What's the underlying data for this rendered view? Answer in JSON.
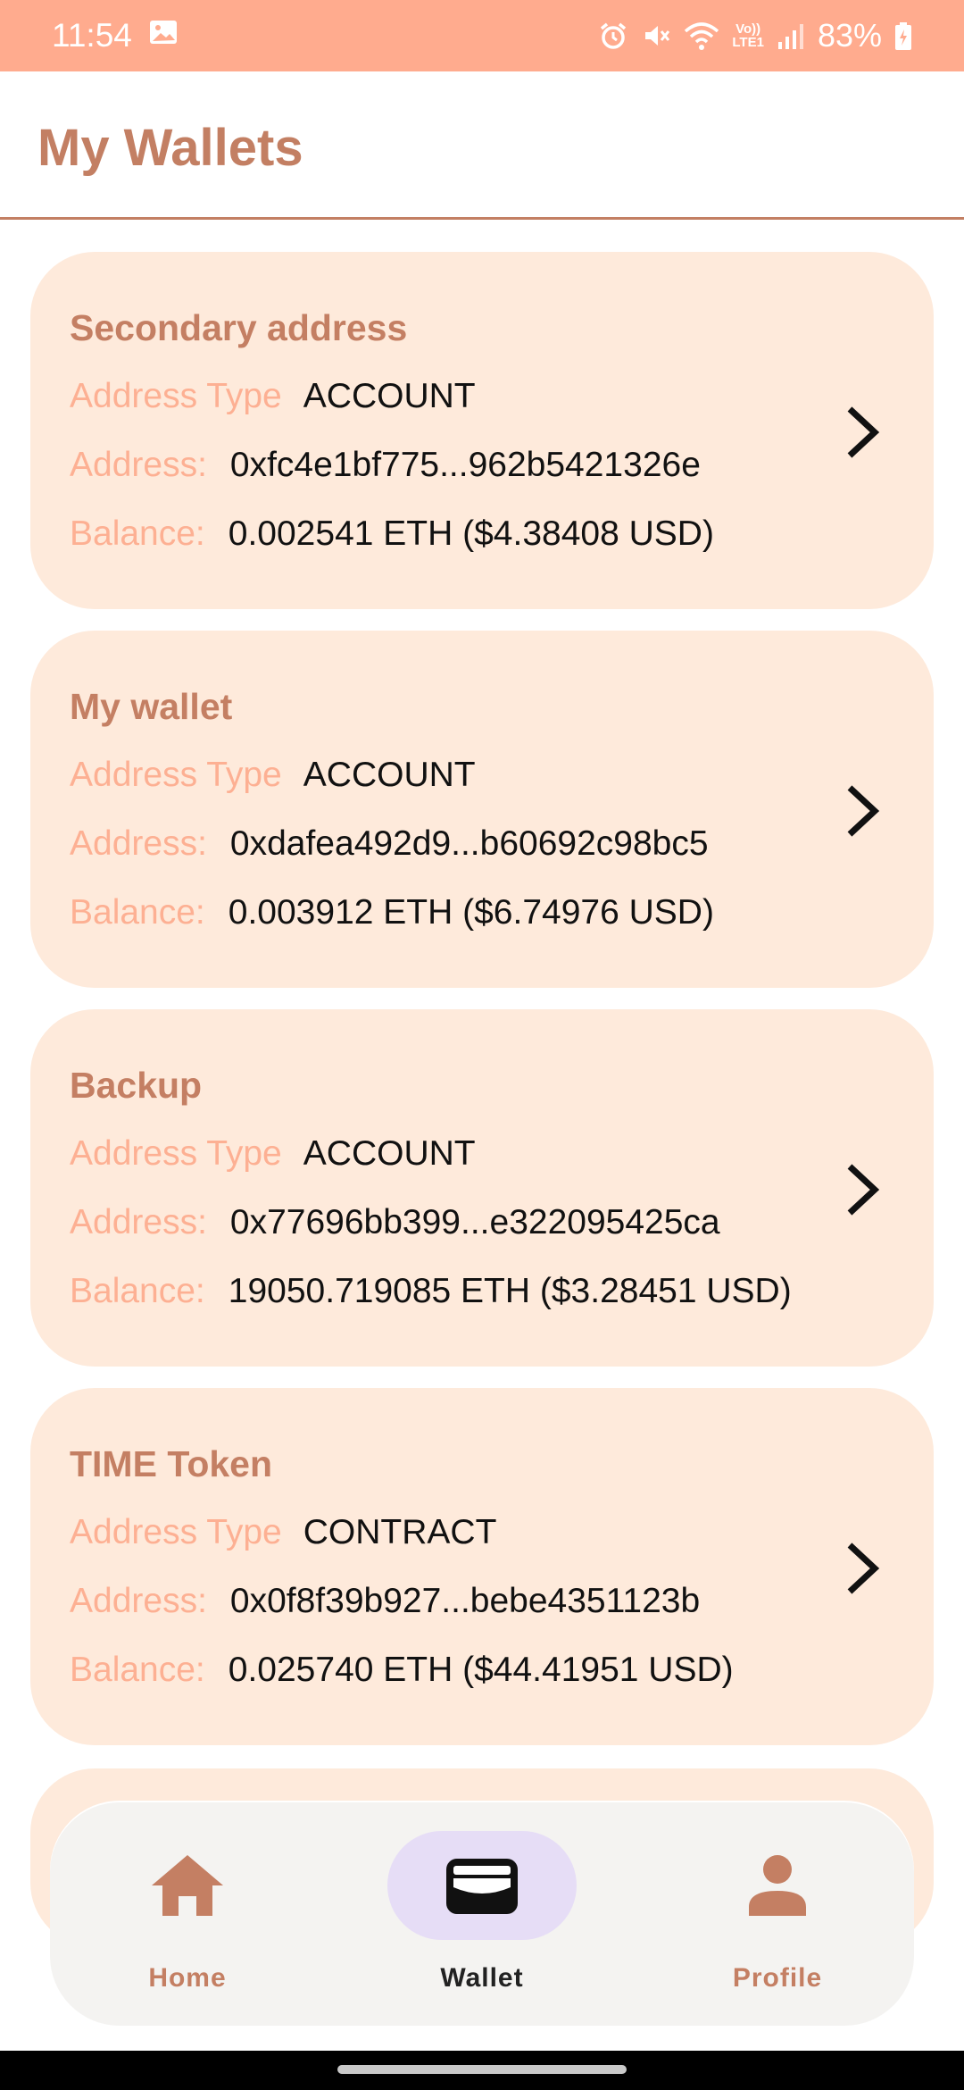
{
  "status_bar": {
    "time": "11:54",
    "battery": "83%",
    "network_label_top": "Vo))",
    "network_label_bottom": "LTE1",
    "icons": [
      "image-icon",
      "alarm-icon",
      "mute-icon",
      "wifi-icon",
      "signal-icon",
      "battery-charging-icon"
    ]
  },
  "header": {
    "title": "My Wallets"
  },
  "labels": {
    "address_type": "Address Type",
    "address": "Address:",
    "balance": "Balance:"
  },
  "wallets": [
    {
      "name": "Secondary address",
      "type": "ACCOUNT",
      "address": "0xfc4e1bf775...962b5421326e",
      "balance": "0.002541 ETH ($4.38408 USD)"
    },
    {
      "name": "My wallet",
      "type": "ACCOUNT",
      "address": "0xdafea492d9...b60692c98bc5",
      "balance": "0.003912 ETH ($6.74976 USD)"
    },
    {
      "name": "Backup",
      "type": "ACCOUNT",
      "address": "0x77696bb399...e322095425ca",
      "balance": "19050.719085 ETH ($3.28451 USD)"
    },
    {
      "name": "TIME Token",
      "type": "CONTRACT",
      "address": "0x0f8f39b927...bebe4351123b",
      "balance": "0.025740 ETH ($44.41951 USD)"
    }
  ],
  "nav": {
    "items": [
      {
        "label": "Home",
        "icon": "home-icon",
        "active": false
      },
      {
        "label": "Wallet",
        "icon": "wallet-icon",
        "active": true
      },
      {
        "label": "Profile",
        "icon": "person-icon",
        "active": false
      }
    ]
  },
  "colors": {
    "status_bar": "#ffab8e",
    "accent": "#c37f63",
    "card_bg": "#feeadb",
    "label": "#fdb093",
    "active_indicator": "#e6ddf6",
    "nav_bg": "#f4f3f1"
  }
}
